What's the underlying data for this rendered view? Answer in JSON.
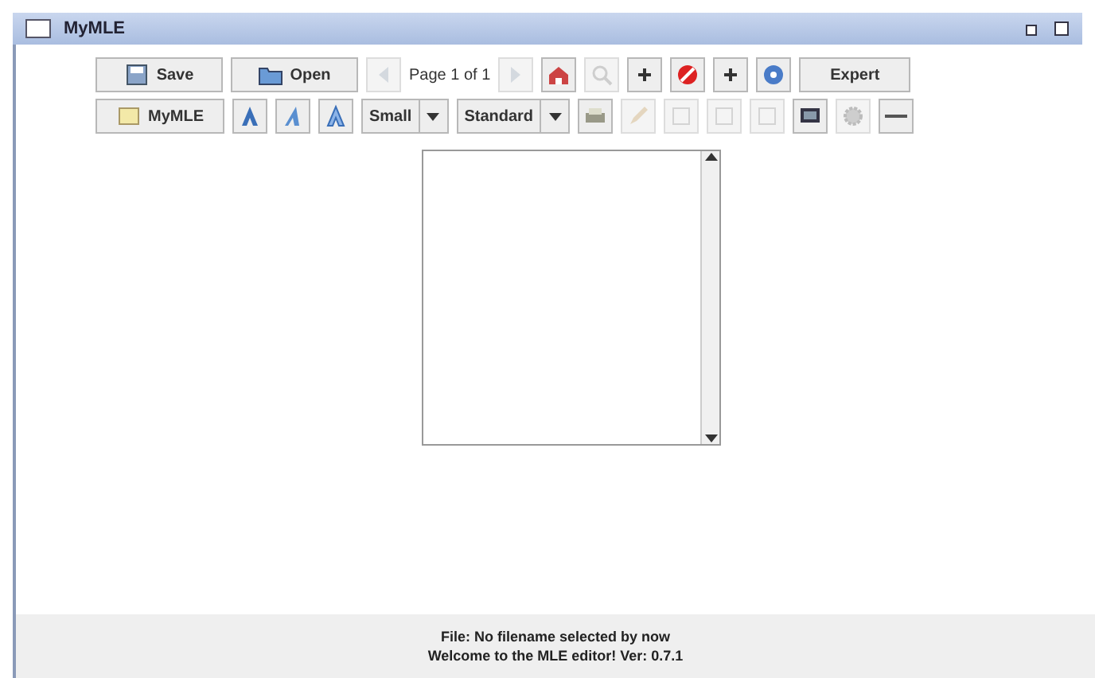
{
  "window": {
    "title": "MyMLE"
  },
  "toolbars": [
    {
      "items": [
        {
          "kind": "text-button",
          "label": "Save"
        },
        {
          "kind": "text-button",
          "label": "Open"
        },
        {
          "kind": "icon-button",
          "disabled": true
        },
        {
          "kind": "label",
          "label": "Page 1 of 1"
        },
        {
          "kind": "icon-button",
          "disabled": true
        },
        {
          "kind": "icon-button",
          "disabled": false
        },
        {
          "kind": "icon-button",
          "disabled": true
        },
        {
          "kind": "icon-button",
          "disabled": false
        },
        {
          "kind": "icon-button",
          "disabled": false
        },
        {
          "kind": "icon-button",
          "disabled": false
        },
        {
          "kind": "icon-button",
          "disabled": false
        },
        {
          "kind": "plain-button",
          "label": "Expert"
        }
      ]
    },
    {
      "items": [
        {
          "kind": "text-button",
          "label": "MyMLE"
        },
        {
          "kind": "icon-button",
          "disabled": false
        },
        {
          "kind": "icon-button",
          "disabled": false
        },
        {
          "kind": "icon-button",
          "disabled": false
        },
        {
          "kind": "select",
          "value": "Small"
        },
        {
          "kind": "select",
          "value": "Standard"
        },
        {
          "kind": "icon-button",
          "disabled": false
        },
        {
          "kind": "icon-button",
          "disabled": true
        },
        {
          "kind": "icon-button",
          "disabled": true
        },
        {
          "kind": "icon-button",
          "disabled": true
        },
        {
          "kind": "icon-button",
          "disabled": true
        },
        {
          "kind": "icon-button",
          "disabled": false
        },
        {
          "kind": "icon-button",
          "disabled": true
        },
        {
          "kind": "icon-button",
          "disabled": false
        }
      ]
    }
  ],
  "status": [
    "File: No filename selected by now",
    "Welcome to the MLE editor! Ver: 0.7.1"
  ]
}
